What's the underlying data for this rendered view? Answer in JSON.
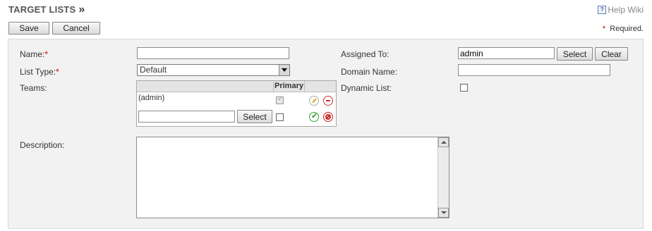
{
  "header": {
    "title": "TARGET LISTS",
    "title_arrow": "»",
    "help_label": "Help Wiki",
    "help_icon": "help-book-icon"
  },
  "toolbar": {
    "save_label": "Save",
    "cancel_label": "Cancel",
    "required_star": "*",
    "required_note": "Required."
  },
  "form": {
    "name": {
      "label": "Name:",
      "required": "*",
      "value": ""
    },
    "list_type": {
      "label": "List Type:",
      "required": "*",
      "value": "Default"
    },
    "teams": {
      "label": "Teams:",
      "primary_header": "Primary",
      "rows": [
        {
          "name": "(admin)",
          "primary_checked": true
        }
      ],
      "new_row": {
        "value": "",
        "select_label": "Select",
        "primary_checked": false
      }
    },
    "description": {
      "label": "Description:",
      "value": ""
    },
    "assigned_to": {
      "label": "Assigned To:",
      "value": "admin",
      "select_label": "Select",
      "clear_label": "Clear"
    },
    "domain_name": {
      "label": "Domain Name:",
      "value": ""
    },
    "dynamic_list": {
      "label": "Dynamic List:",
      "checked": false
    }
  },
  "colors": {
    "required_star": "#cc0000",
    "panel_bg": "#f2f2f2"
  }
}
